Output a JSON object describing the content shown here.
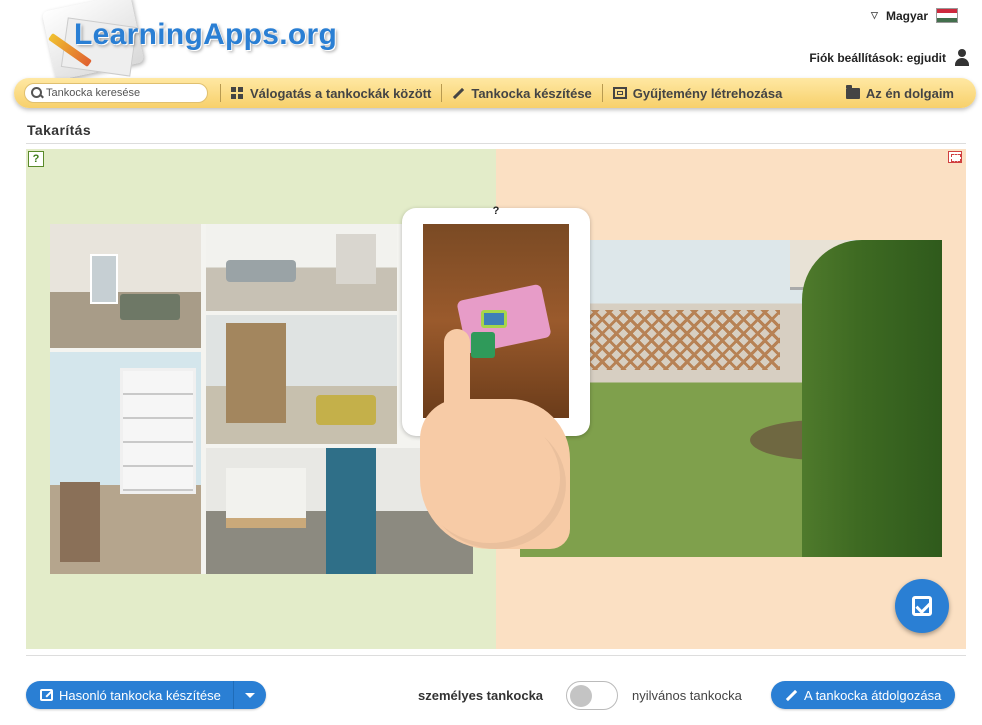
{
  "header": {
    "logo_text": "LearningApps.org",
    "language": "Magyar",
    "account_label": "Fiók beállítások: egjudit",
    "flag_colors": [
      "#cd2a3e",
      "#ffffff",
      "#436f4d"
    ]
  },
  "nav": {
    "search_placeholder": "Tankocka keresése",
    "items": [
      {
        "label": "Válogatás a tankockák között",
        "icon": "grid-icon"
      },
      {
        "label": "Tankocka készítése",
        "icon": "pencil-icon"
      },
      {
        "label": "Gyűjtemény létrehozása",
        "icon": "collection-icon"
      },
      {
        "label": "Az én dolgaim",
        "icon": "folder-icon"
      }
    ]
  },
  "page": {
    "title": "Takarítás"
  },
  "app": {
    "tablet_hint": "?",
    "left_background": "#e3ecc9",
    "right_background": "#fbe0c3"
  },
  "footer": {
    "similar_button": "Hasonló tankocka készítése",
    "toggle_left_label": "személyes tankocka",
    "toggle_right_label": "nyilvános tankocka",
    "rework_button": "A tankocka átdolgozása",
    "accent_color": "#2a7fd4"
  }
}
